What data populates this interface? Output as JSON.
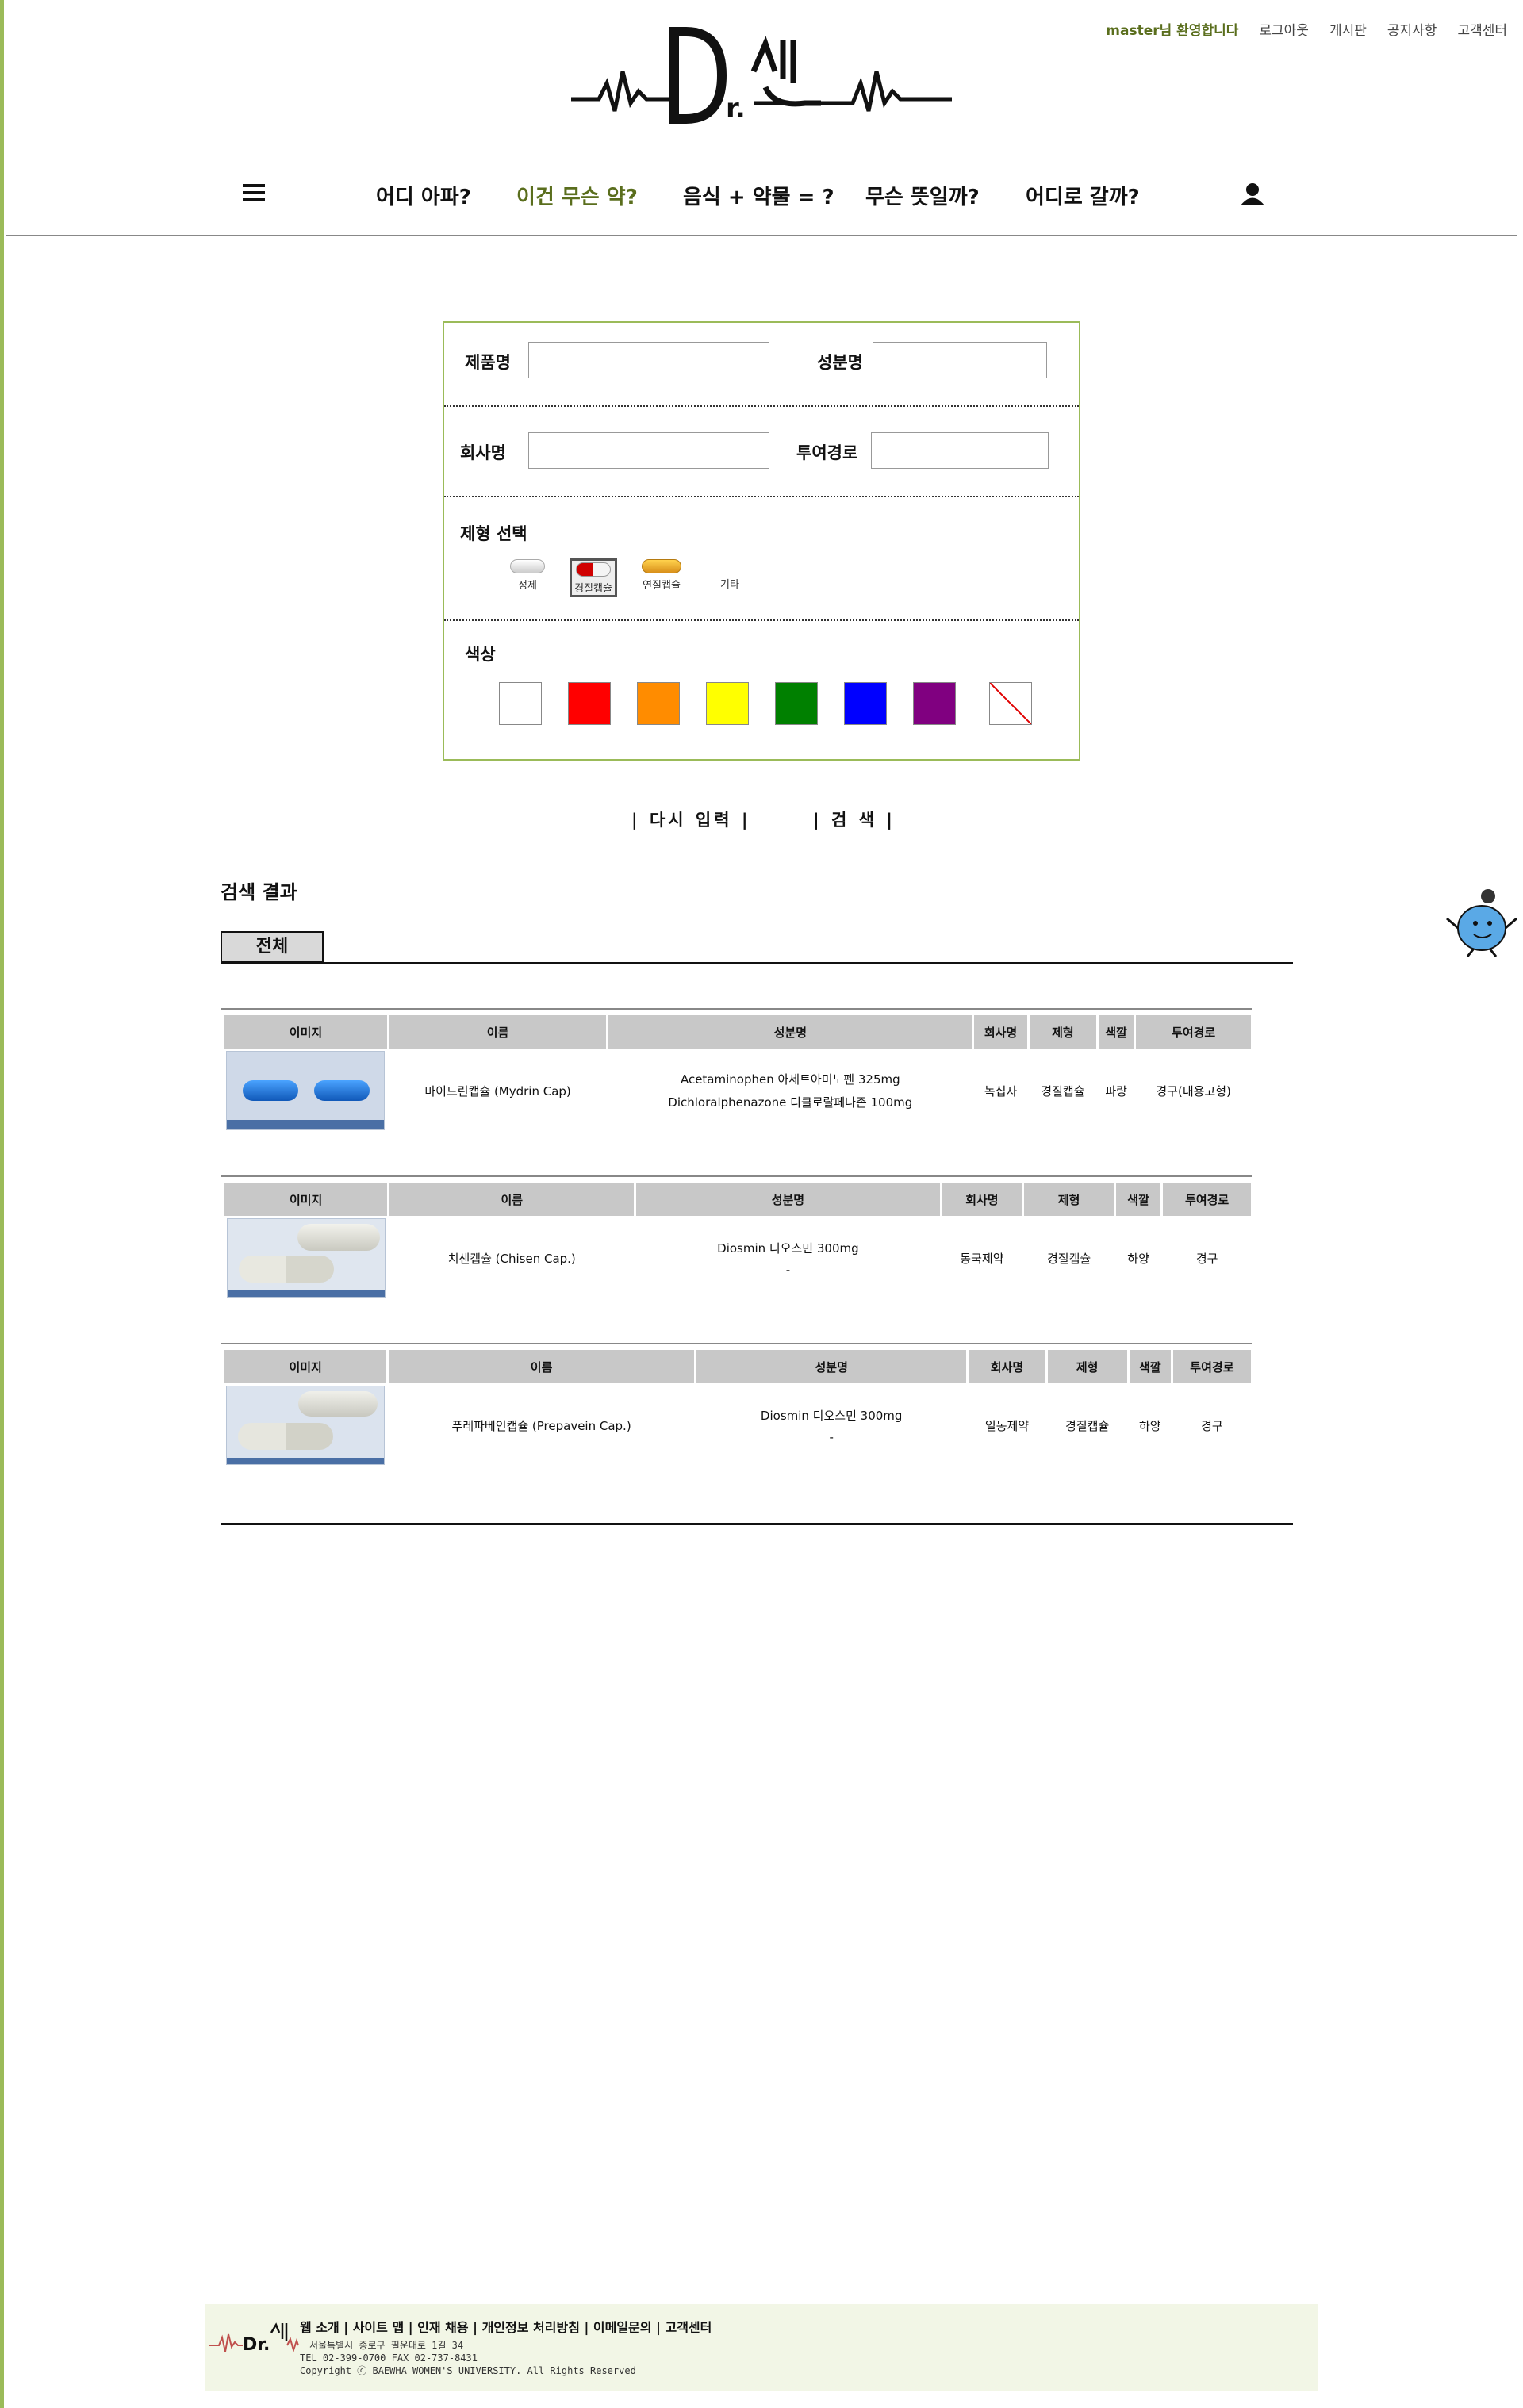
{
  "header": {
    "welcome": "master님 환영합니다",
    "links": [
      "로그아웃",
      "게시판",
      "공지사항",
      "고객센터"
    ],
    "logo_text": "Dr.센스"
  },
  "nav": {
    "items": [
      "어디 아파?",
      "이건 무슨 약?",
      "음식 + 약물 = ?",
      "무슨 뜻일까?",
      "어디로 갈까?"
    ],
    "active_index": 1
  },
  "search": {
    "product_label": "제품명",
    "ingredient_label": "성분명",
    "company_label": "회사명",
    "route_label": "투여경로",
    "product_value": "",
    "ingredient_value": "",
    "company_value": "",
    "route_value": "",
    "shape_label": "제형 선택",
    "shapes": [
      "정제",
      "경질캡슐",
      "연질캡슐",
      "기타"
    ],
    "selected_shape": "경질캡슐",
    "color_label": "색상",
    "colors": [
      "#ffffff",
      "#ff0000",
      "#ff8c00",
      "#ffff00",
      "#008000",
      "#0000ff",
      "#800080",
      "none"
    ],
    "reset_button": "| 다시 입력 |",
    "search_button": "| 검 색 |"
  },
  "results": {
    "title": "검색 결과",
    "tab_all": "전체",
    "headers": [
      "이미지",
      "이름",
      "성분명",
      "회사명",
      "제형",
      "색깔",
      "투여경로"
    ],
    "rows": [
      {
        "name": "마이드린캡슐 (Mydrin Cap)",
        "ingredients": [
          "Acetaminophen 아세트아미노펜 325mg",
          "Dichloralphenazone 디클로랄페나존 100mg"
        ],
        "company": "녹십자",
        "form": "경질캡슐",
        "color": "파랑",
        "route": "경구(내용고형)"
      },
      {
        "name": "치센캡슐 (Chisen Cap.)",
        "ingredients": [
          "Diosmin   디오스민   300mg",
          "-"
        ],
        "company": "동국제약",
        "form": "경질캡슐",
        "color": "하양",
        "route": "경구"
      },
      {
        "name": "푸레파베인캡슐 (Prepavein Cap.)",
        "ingredients": [
          "Diosmin   디오스민   300mg",
          "-"
        ],
        "company": "일동제약",
        "form": "경질캡슐",
        "color": "하양",
        "route": "경구"
      }
    ]
  },
  "footer": {
    "links": "웹 소개 | 사이트 맵 | 인재 채용 | 개인정보 처리방침 | 이메일문의 | 고객센터",
    "address": "서울특별시 종로구 필운대로 1길 34",
    "tel": "TEL 02-399-0700 FAX 02-737-8431",
    "copyright": "Copyright ⓒ BAEWHA WOMEN'S UNIVERSITY. All Rights Reserved"
  }
}
